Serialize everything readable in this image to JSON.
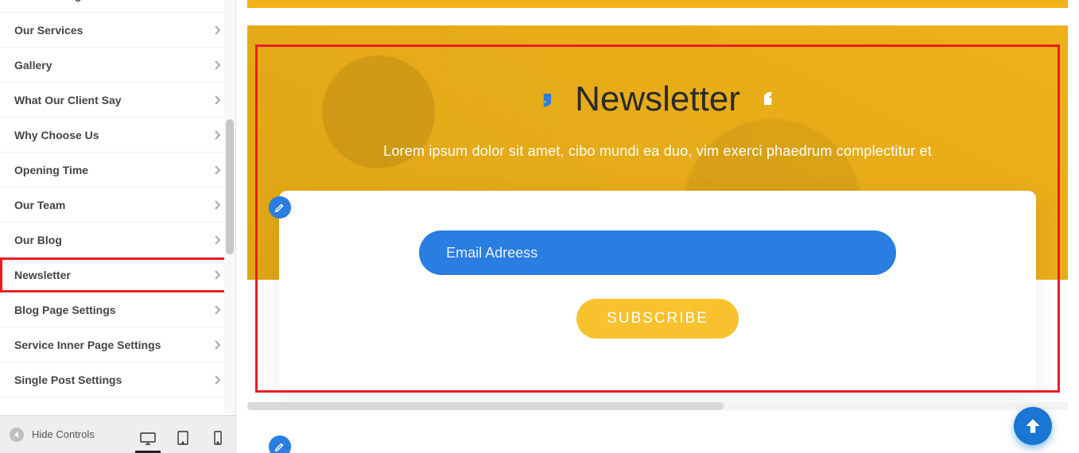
{
  "sidebar": {
    "items": [
      {
        "label": "Our Working Process"
      },
      {
        "label": "Our Services"
      },
      {
        "label": "Gallery"
      },
      {
        "label": "What Our Client Say"
      },
      {
        "label": "Why Choose Us"
      },
      {
        "label": "Opening Time"
      },
      {
        "label": "Our Team"
      },
      {
        "label": "Our Blog"
      },
      {
        "label": "Newsletter"
      },
      {
        "label": "Blog Page Settings"
      },
      {
        "label": "Service Inner Page Settings"
      },
      {
        "label": "Single Post Settings"
      }
    ],
    "highlight_index": 8
  },
  "footer": {
    "hide_controls_label": "Hide Controls",
    "active_device": "desktop"
  },
  "newsletter": {
    "title": "Newsletter",
    "subtitle": "Lorem ipsum dolor sit amet, cibo mundi ea duo, vim exerci phaedrum complectitur et",
    "email_placeholder": "Email Adreess",
    "subscribe_label": "SUBSCRIBE"
  },
  "colors": {
    "accent_blue": "#2a7de1",
    "mustard": "#f2b218",
    "highlight_red": "#ec1c24"
  }
}
